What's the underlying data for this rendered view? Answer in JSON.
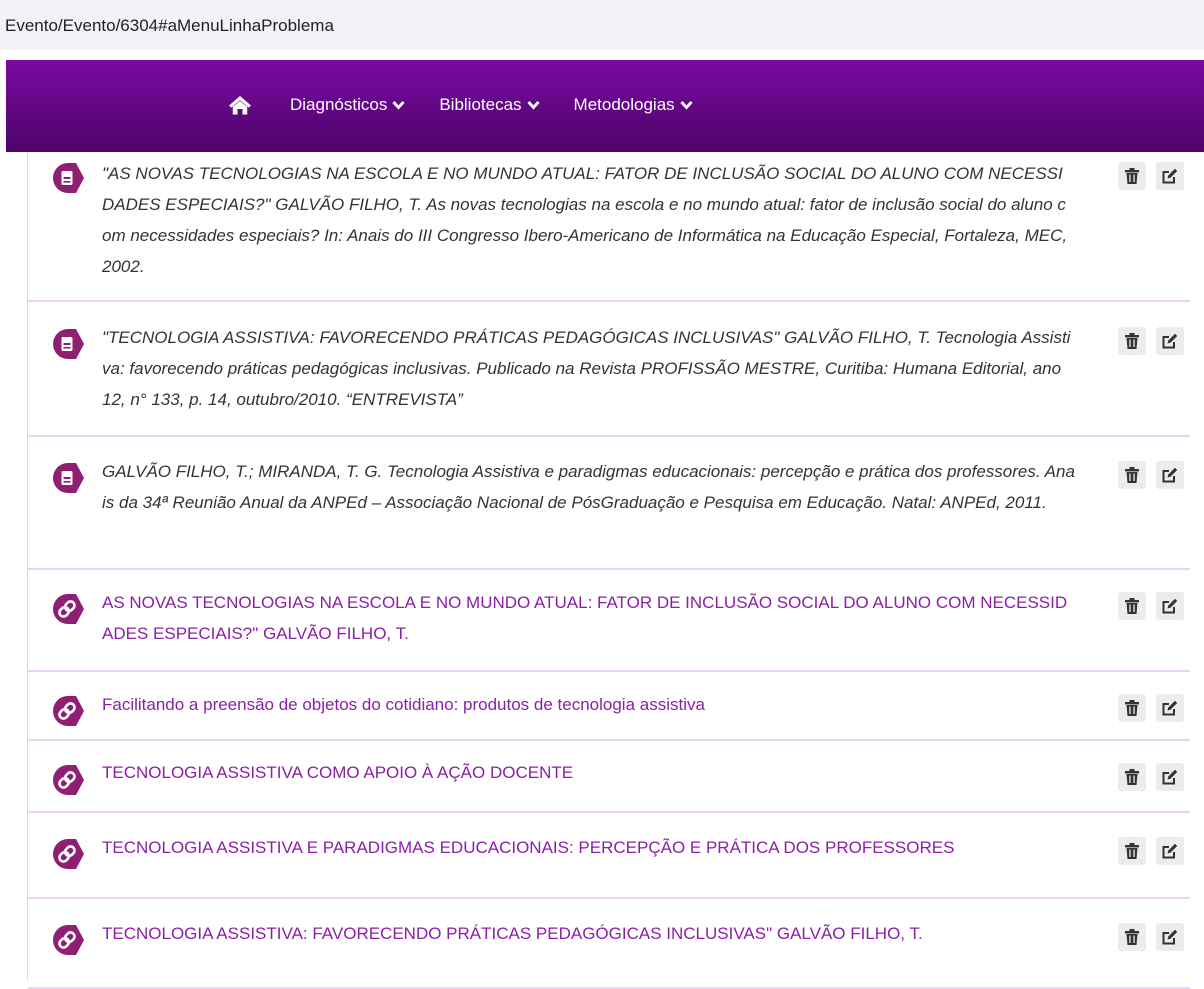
{
  "browser": {
    "url": "Evento/Evento/6304#aMenuLinhaProblema"
  },
  "nav": {
    "home_icon": "home-icon",
    "items": [
      {
        "label": "Diagnósticos"
      },
      {
        "label": "Bibliotecas"
      },
      {
        "label": "Metodologias"
      }
    ]
  },
  "colors": {
    "nav_start": "#7a0aa3",
    "nav_end": "#4c0467",
    "icon_bg": "#8e1f72",
    "link_text": "#8b1fa6",
    "separator": "#ecd2f5"
  },
  "references": [
    {
      "type": "book",
      "icon": "book-icon",
      "text": "\"AS NOVAS TECNOLOGIAS NA ESCOLA E NO MUNDO ATUAL: FATOR DE INCLUSÃO SOCIAL DO ALUNO COM NECESSIDADES ESPECIAIS?\" GALVÃO FILHO, T. As novas tecnologias na escola e no mundo atual: fator de inclusão social do aluno com necessidades especiais? In: Anais do III Congresso Ibero-Americano de Informática na Educação Especial, Fortaleza, MEC, 2002."
    },
    {
      "type": "book",
      "icon": "book-icon",
      "text": "\"TECNOLOGIA ASSISTIVA: FAVORECENDO PRÁTICAS PEDAGÓGICAS INCLUSIVAS\" GALVÃO FILHO, T. Tecnologia Assistiva: favorecendo práticas pedagógicas inclusivas. Publicado na Revista PROFISSÃO MESTRE, Curitiba: Humana Editorial, ano 12, n° 133, p. 14, outubro/2010. “ENTREVISTA”"
    },
    {
      "type": "book",
      "icon": "book-icon",
      "text": "GALVÃO FILHO, T.; MIRANDA, T. G. Tecnologia Assistiva e paradigmas educacionais: percepção e prática dos professores. Anais da 34ª Reunião Anual da ANPEd – Associação Nacional de PósGraduação e Pesquisa em Educação. Natal: ANPEd, 2011."
    },
    {
      "type": "link",
      "icon": "link-icon",
      "text": "AS NOVAS TECNOLOGIAS NA ESCOLA E NO MUNDO ATUAL: FATOR DE INCLUSÃO SOCIAL DO ALUNO COM NECESSIDADES ESPECIAIS?\" GALVÃO FILHO, T."
    },
    {
      "type": "link",
      "icon": "link-icon",
      "text": "Facilitando a preensão de objetos do cotidiano: produtos de tecnologia assistiva"
    },
    {
      "type": "link",
      "icon": "link-icon",
      "text": "TECNOLOGIA ASSISTIVA COMO APOIO À AÇÃO DOCENTE"
    },
    {
      "type": "link",
      "icon": "link-icon",
      "text": "TECNOLOGIA ASSISTIVA E PARADIGMAS EDUCACIONAIS: PERCEPÇÃO E PRÁTICA DOS PROFESSORES"
    },
    {
      "type": "link",
      "icon": "link-icon",
      "text": "TECNOLOGIA ASSISTIVA: FAVORECENDO PRÁTICAS PEDAGÓGICAS INCLUSIVAS\" GALVÃO FILHO, T."
    }
  ],
  "actions": {
    "delete_icon": "trash-icon",
    "edit_icon": "edit-icon"
  }
}
